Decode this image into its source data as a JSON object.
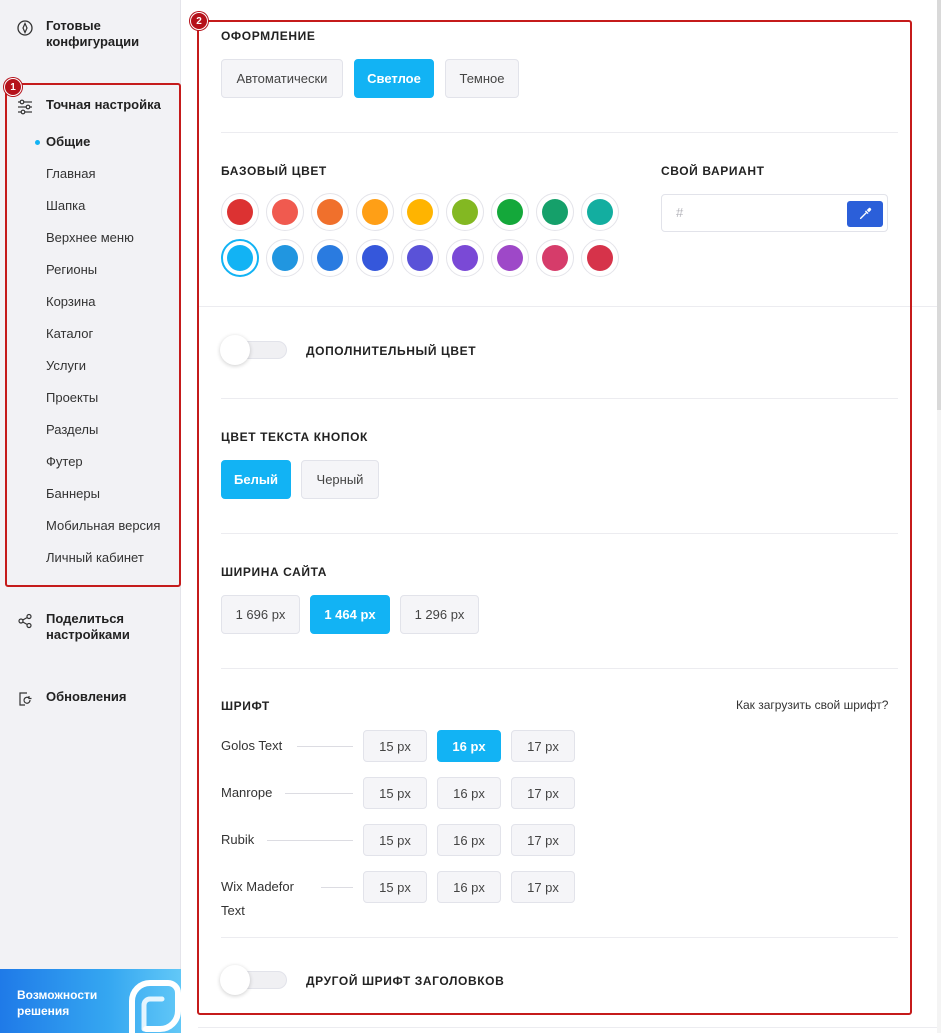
{
  "sidebar": {
    "ready_configs": "Готовые конфигурации",
    "fine_tuning": "Точная настройка",
    "sub_items": [
      {
        "label": "Общие",
        "active": true
      },
      {
        "label": "Главная"
      },
      {
        "label": "Шапка"
      },
      {
        "label": "Верхнее меню"
      },
      {
        "label": "Регионы"
      },
      {
        "label": "Корзина"
      },
      {
        "label": "Каталог"
      },
      {
        "label": "Услуги"
      },
      {
        "label": "Проекты"
      },
      {
        "label": "Разделы"
      },
      {
        "label": "Футер"
      },
      {
        "label": "Баннеры"
      },
      {
        "label": "Мобильная версия"
      },
      {
        "label": "Личный кабинет"
      }
    ],
    "share": "Поделиться настройками",
    "updates": "Обновления",
    "promo": "Возможности решения"
  },
  "badges": {
    "one": "1",
    "two": "2"
  },
  "appearance": {
    "title": "ОФОРМЛЕНИЕ",
    "options": [
      "Автоматически",
      "Светлое",
      "Темное"
    ],
    "selected": "Светлое"
  },
  "base_color": {
    "title": "БАЗОВЫЙ ЦВЕТ",
    "custom_title": "СВОЙ ВАРИАНТ",
    "custom_placeholder": "#",
    "row1": [
      "#dc3232",
      "#f05a4f",
      "#f0702c",
      "#ff9f16",
      "#ffb400",
      "#83b822",
      "#14a83a",
      "#15a06a",
      "#13aea0"
    ],
    "row2": [
      "#12b3f4",
      "#2196e0",
      "#2a7be0",
      "#3557db",
      "#5a52d8",
      "#7a49d6",
      "#9e48c8",
      "#d63c6a",
      "#d6334a"
    ],
    "selected": "#12b3f4"
  },
  "extra_color": {
    "label": "ДОПОЛНИТЕЛЬНЫЙ ЦВЕТ",
    "enabled": false
  },
  "button_text": {
    "title": "ЦВЕТ ТЕКСТА КНОПОК",
    "options": [
      "Белый",
      "Черный"
    ],
    "selected": "Белый"
  },
  "site_width": {
    "title": "ШИРИНА САЙТА",
    "options": [
      "1 696 px",
      "1 464 px",
      "1 296 px"
    ],
    "selected": "1 464 px"
  },
  "font": {
    "title": "ШРИФТ",
    "link": "Как загрузить свой шрифт?",
    "rows": [
      {
        "name": "Golos Text",
        "sizes": [
          "15 px",
          "16 px",
          "17 px"
        ],
        "selected": "16 px"
      },
      {
        "name": "Manrope",
        "sizes": [
          "15 px",
          "16 px",
          "17 px"
        ]
      },
      {
        "name": "Rubik",
        "sizes": [
          "15 px",
          "16 px",
          "17 px"
        ]
      },
      {
        "name": "Wix Madefor Text",
        "sizes": [
          "15 px",
          "16 px",
          "17 px"
        ]
      }
    ]
  },
  "heading_font": {
    "label": "ДРУГОЙ ШРИФТ ЗАГОЛОВКОВ",
    "enabled": false
  },
  "colors": {
    "accent": "#12b3f4",
    "highlight_box": "#c51b1b",
    "picker": "#2b5fd9"
  }
}
